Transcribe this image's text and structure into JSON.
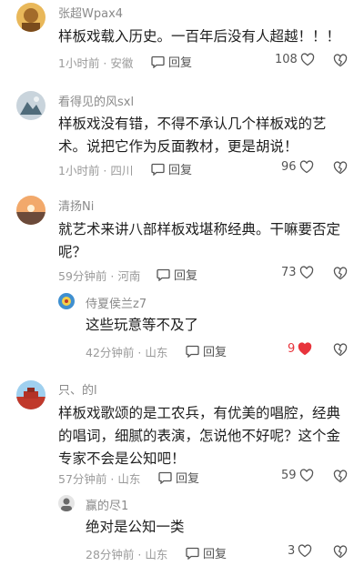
{
  "comments": [
    {
      "user": "张超Wpax4",
      "text": "样板戏载入历史。一百年后没有人超越！！！",
      "meta": "1小时前 · 安徽",
      "reply_label": "回复",
      "likes": "108",
      "liked": false
    },
    {
      "user": "看得见的风sxl",
      "text": "样板戏没有错，不得不承认几个样板戏的艺术。说把它作为反面教材，更是胡说！",
      "meta": "1小时前 · 四川",
      "reply_label": "回复",
      "likes": "96",
      "liked": false
    },
    {
      "user": "清扬Ni",
      "text": "就艺术来讲八部样板戏堪称经典。干嘛要否定呢？",
      "meta": "59分钟前 · 河南",
      "reply_label": "回复",
      "likes": "73",
      "liked": false,
      "replies": [
        {
          "user": "侍夏侯兰z7",
          "text": "这些玩意等不及了",
          "meta": "42分钟前 · 山东",
          "reply_label": "回复",
          "likes": "9",
          "liked": true
        }
      ]
    },
    {
      "user": "只、的l",
      "text": "样板戏歌颂的是工农兵，有优美的唱腔，经典的唱词，细腻的表演，怎说他不好呢？这个金专家不会是公知吧！",
      "meta": "57分钟前 · 山东",
      "reply_label": "回复",
      "likes": "59",
      "liked": false,
      "replies": [
        {
          "user": "赢的尽1",
          "text": "绝对是公知一类",
          "meta": "28分钟前 · 山东",
          "reply_label": "回复",
          "likes": "3",
          "liked": false
        }
      ]
    }
  ],
  "colors": {
    "meta": "#9a9a9a",
    "liked": "#e8343c",
    "name": "#8a8a8a"
  },
  "icons": {
    "reply": "chat-bubble-icon",
    "like": "heart-icon",
    "dislike": "broken-heart-icon"
  }
}
